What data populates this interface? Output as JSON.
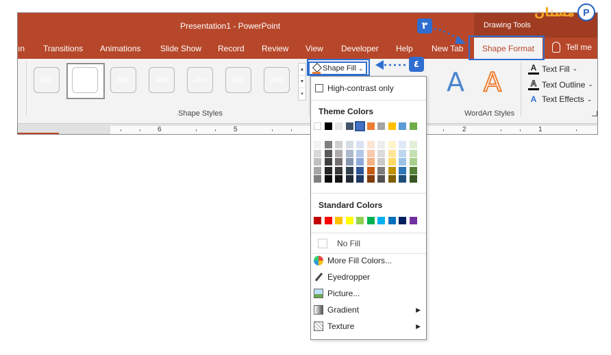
{
  "app": {
    "title": "Presentation1  -  PowerPoint",
    "context_tab_group": "Drawing Tools",
    "logo_text": "مستان",
    "logo_mark": "P"
  },
  "tabs": [
    {
      "label": "ın"
    },
    {
      "label": "Transitions"
    },
    {
      "label": "Animations"
    },
    {
      "label": "Slide Show"
    },
    {
      "label": "Record"
    },
    {
      "label": "Review"
    },
    {
      "label": "View"
    },
    {
      "label": "Developer"
    },
    {
      "label": "Help"
    },
    {
      "label": "New Tab"
    },
    {
      "label": "Shape Format",
      "active": true
    }
  ],
  "tell_me": "Tell me",
  "ribbon": {
    "shape_styles": {
      "label": "Shape Styles",
      "swatches": [
        {
          "text": "Abc",
          "color": "#000000"
        },
        {
          "text": "Abc",
          "color": "#4472c4"
        },
        {
          "text": "Abc",
          "color": "#ed7d31"
        },
        {
          "text": "Abc",
          "color": "#a5a5a5"
        },
        {
          "text": "Abc",
          "color": "#ffc000"
        },
        {
          "text": "Abc",
          "color": "#5b9bd5"
        },
        {
          "text": "Abc",
          "color": "#70ad47"
        }
      ]
    },
    "shape_fill_label": "Shape Fill",
    "wordart": {
      "label": "WordArt Styles",
      "letter": "A",
      "text_fill": "Text Fill",
      "text_outline": "Text Outline",
      "text_effects": "Text Effects"
    }
  },
  "ruler": {
    "labels": [
      "6",
      "5",
      "2",
      "1"
    ]
  },
  "dropdown": {
    "high_contrast": "High-contrast only",
    "theme_colors_heading": "Theme Colors",
    "theme_top": [
      "#ffffff",
      "#000000",
      "#e7e6e6",
      "#44546a",
      "#4472c4",
      "#ed7d31",
      "#a5a5a5",
      "#ffc000",
      "#5b9bd5",
      "#70ad47"
    ],
    "theme_shades": [
      [
        "#f2f2f2",
        "#7f7f7f",
        "#d0cece",
        "#d6dce4",
        "#d9e2f3",
        "#fbe5d5",
        "#ededed",
        "#fff2cc",
        "#deebf6",
        "#e2efd9"
      ],
      [
        "#d8d8d8",
        "#595959",
        "#aeabab",
        "#adb9ca",
        "#b4c6e7",
        "#f7cbac",
        "#dbdbdb",
        "#fee599",
        "#bdd7ee",
        "#c5e0b3"
      ],
      [
        "#bfbfbf",
        "#3f3f3f",
        "#757070",
        "#8496b0",
        "#8eaadb",
        "#f4b183",
        "#c9c9c9",
        "#ffd965",
        "#9cc3e5",
        "#a8d08d"
      ],
      [
        "#a5a5a5",
        "#262626",
        "#3a3838",
        "#323f4f",
        "#2f5496",
        "#c55a11",
        "#7b7b7b",
        "#bf9000",
        "#2e75b5",
        "#538135"
      ],
      [
        "#7f7f7f",
        "#0c0c0c",
        "#171616",
        "#222a35",
        "#1f3864",
        "#833c0b",
        "#525252",
        "#7f6000",
        "#1e4e79",
        "#375623"
      ]
    ],
    "standard_colors_heading": "Standard Colors",
    "standard_colors": [
      "#c00000",
      "#ff0000",
      "#ffc000",
      "#ffff00",
      "#92d050",
      "#00b050",
      "#00b0f0",
      "#0070c0",
      "#002060",
      "#7030a0"
    ],
    "no_fill": "No Fill",
    "items": [
      {
        "label": "More Fill Colors...",
        "icon": "color-wheel-icon"
      },
      {
        "label": "Eyedropper",
        "icon": "eyedropper-icon"
      },
      {
        "label": "Picture...",
        "icon": "picture-icon"
      },
      {
        "label": "Gradient",
        "icon": "gradient-icon",
        "submenu": true
      },
      {
        "label": "Texture",
        "icon": "texture-icon",
        "submenu": true
      }
    ]
  },
  "annotations": {
    "step3": "٣",
    "step4": "٤"
  }
}
